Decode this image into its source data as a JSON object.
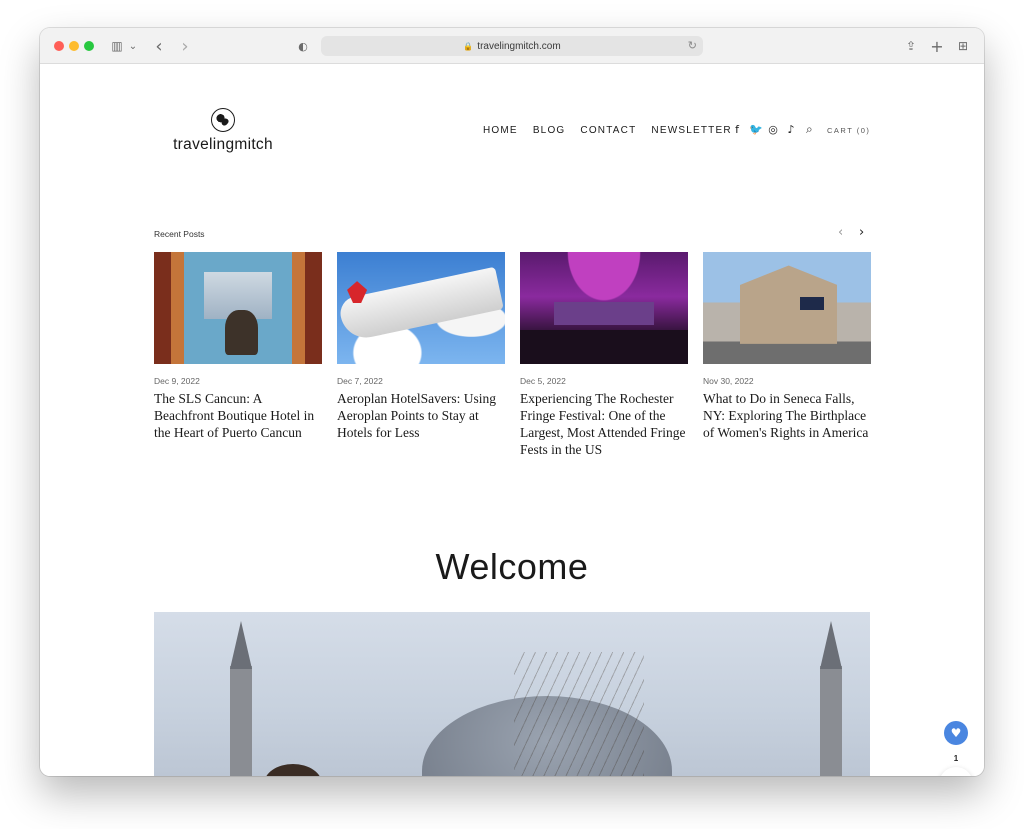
{
  "browser": {
    "url": "travelingmitch.com",
    "lock_glyph": "🔒",
    "reload_glyph": "↻",
    "sidebar_glyph": "▥",
    "sidebar_chevron": "⌄",
    "back_glyph": "‹",
    "forward_glyph": "›",
    "shield_glyph": "◐",
    "share_glyph": "⇪",
    "newtab_glyph": "+",
    "tabs_glyph": "⊞"
  },
  "site": {
    "logo_text": "travelingmitch",
    "nav": [
      "HOME",
      "BLOG",
      "CONTACT",
      "NEWSLETTER"
    ],
    "social_icons": [
      "facebook-icon",
      "twitter-icon",
      "instagram-icon",
      "tiktok-icon"
    ],
    "social_glyphs": [
      "f",
      "🐦",
      "◎",
      "♪"
    ],
    "search_glyph": "⌕",
    "cart_label": "CART (0)"
  },
  "recent": {
    "label": "Recent Posts",
    "prev_glyph": "‹",
    "next_glyph": "›",
    "posts": [
      {
        "date": "Dec 9, 2022",
        "title": "The SLS Cancun: A Beachfront Boutique Hotel in the Heart of Puerto Cancun"
      },
      {
        "date": "Dec 7, 2022",
        "title": "Aeroplan HotelSavers: Using Aeroplan Points to Stay at Hotels for Less"
      },
      {
        "date": "Dec 5, 2022",
        "title": "Experiencing The Rochester Fringe Festival: One of the Largest, Most Attended Fringe Fests in the US"
      },
      {
        "date": "Nov 30, 2022",
        "title": "What to Do in Seneca Falls, NY: Exploring The Birthplace of Women's Rights in America"
      }
    ]
  },
  "welcome": {
    "heading": "Welcome"
  },
  "floating": {
    "heart_glyph": "♥",
    "heart_count": "1",
    "share_glyph": "⋖"
  },
  "colors": {
    "accent_blue": "#4a86e0",
    "text": "#1a1a1a"
  }
}
